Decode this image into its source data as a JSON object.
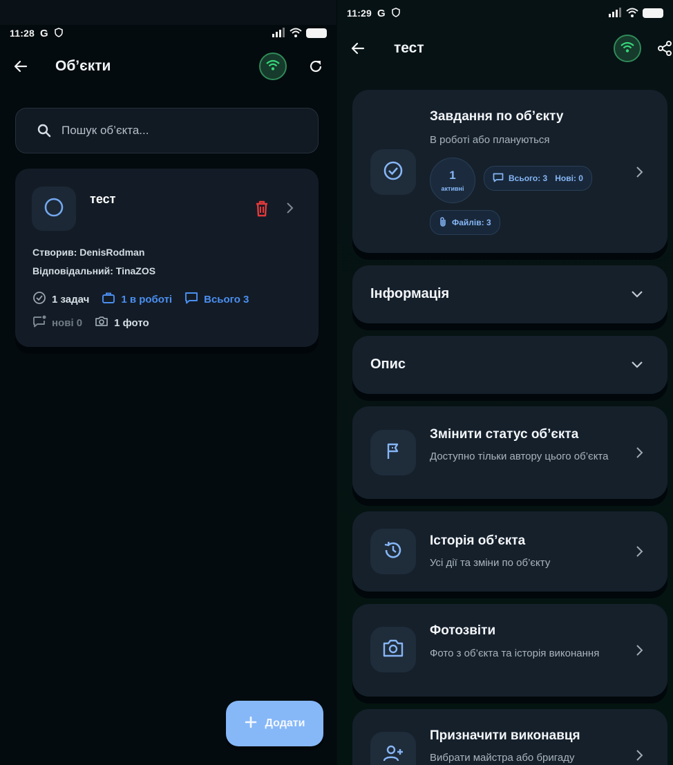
{
  "left": {
    "status": {
      "time": "11:28",
      "g": "G"
    },
    "appbar": {
      "title": "Об’єкти"
    },
    "search": {
      "placeholder": "Пошук об’єкта..."
    },
    "object": {
      "name": "тест",
      "created_by": "Створив: DenisRodman",
      "responsible": "Відповідальний: TinaZOS",
      "tasks": "1 задач",
      "in_work": "1 в роботі",
      "total": "Всього 3",
      "new": "нові 0",
      "photos": "1 фото"
    },
    "fab": {
      "label": "Додати"
    }
  },
  "right": {
    "status": {
      "time": "11:29",
      "g": "G"
    },
    "appbar": {
      "title": "тест"
    },
    "tasks_card": {
      "title": "Завдання по об’єкту",
      "subtitle": "В роботі або плануються",
      "active_count": "1",
      "active_label": "активні",
      "messages": "Всього: 3",
      "new": "Нові: 0",
      "files": "Файлів: 3"
    },
    "info": {
      "title": "Інформація"
    },
    "description": {
      "title": "Опис"
    },
    "status_card": {
      "title": "Змінити статус об’єкта",
      "subtitle": "Доступно тільки автору цього об’єкта"
    },
    "history_card": {
      "title": "Історія об’єкта",
      "subtitle": "Усі дії та зміни по об’єкту"
    },
    "photo_card": {
      "title": "Фотозвіти",
      "subtitle": "Фото з об’єкта та історія виконання"
    },
    "assign_card": {
      "title": "Призначити виконавця",
      "subtitle": "Вибрати майстра або бригаду"
    }
  },
  "colors": {
    "accent_blue": "#4b8ff2",
    "wifi_green": "#37d67a",
    "danger_red": "#e5393b",
    "fab_blue": "#86b8f8"
  },
  "icons": [
    "back-arrow-icon",
    "wifi-icon",
    "refresh-icon",
    "search-icon",
    "circle-icon",
    "trash-icon",
    "chevron-right-icon",
    "check-circle-icon",
    "briefcase-icon",
    "chat-icon",
    "new-message-icon",
    "camera-icon",
    "plus-icon",
    "share-icon",
    "message-icon",
    "paperclip-icon",
    "chevron-down-icon",
    "flag-icon",
    "history-icon",
    "add-person-icon"
  ]
}
